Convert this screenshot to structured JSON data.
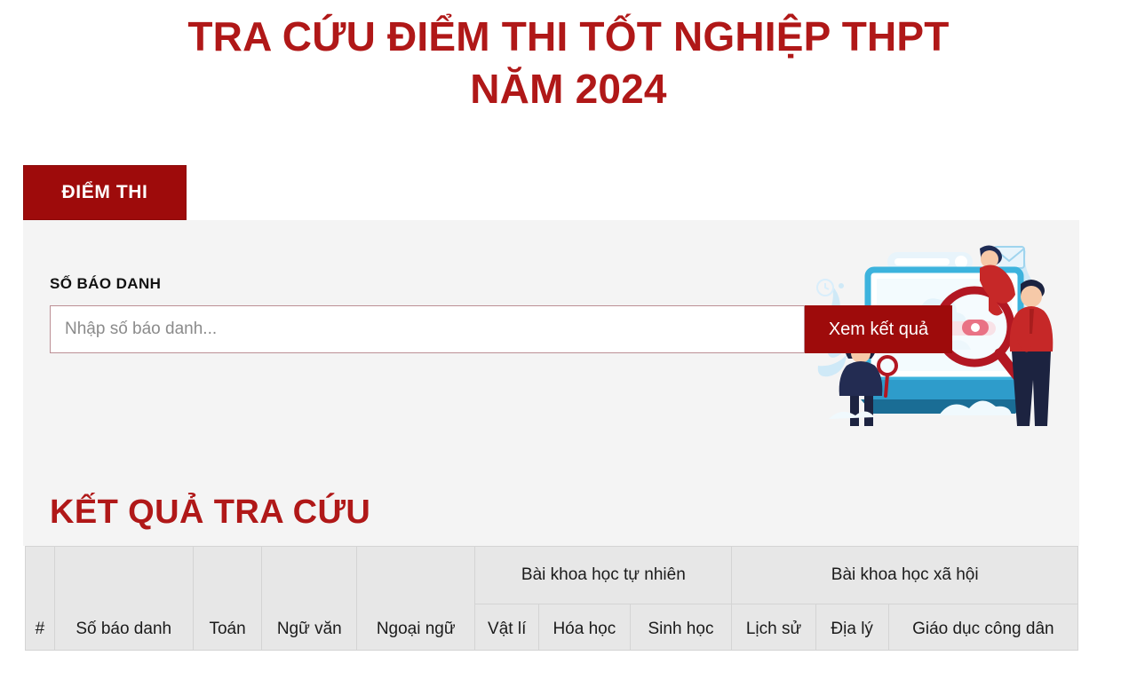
{
  "page": {
    "title_line1": "TRA CỨU ĐIỂM THI TỐT NGHIỆP THPT",
    "title_line2": "NĂM 2024",
    "title_color": "#b01818"
  },
  "tabs": [
    {
      "label": "ĐIỂM THI",
      "active": true,
      "color": "#9e0b0b"
    }
  ],
  "search": {
    "label": "SỐ BÁO DANH",
    "placeholder": "Nhập số báo danh...",
    "value": "",
    "button_label": "Xem kết quả",
    "button_color": "#9e0b0b",
    "input_border_color": "#bc8f95"
  },
  "illustration": {
    "name": "search-illustration",
    "description": "Minh họa tra cứu: màn hình máy tính, kính lúp đỏ, hai nhân vật"
  },
  "results": {
    "heading": "KẾT QUẢ TRA CỨU",
    "heading_color": "#b01818",
    "group_headers": [
      {
        "label": "Bài khoa học tự nhiên",
        "span": 3
      },
      {
        "label": "Bài khoa học xã hội",
        "span": 3
      }
    ],
    "columns": [
      "#",
      "Số báo danh",
      "Toán",
      "Ngữ văn",
      "Ngoại ngữ",
      "Vật lí",
      "Hóa học",
      "Sinh học",
      "Lịch sử",
      "Địa lý",
      "Giáo dục công dân"
    ],
    "rows": []
  }
}
